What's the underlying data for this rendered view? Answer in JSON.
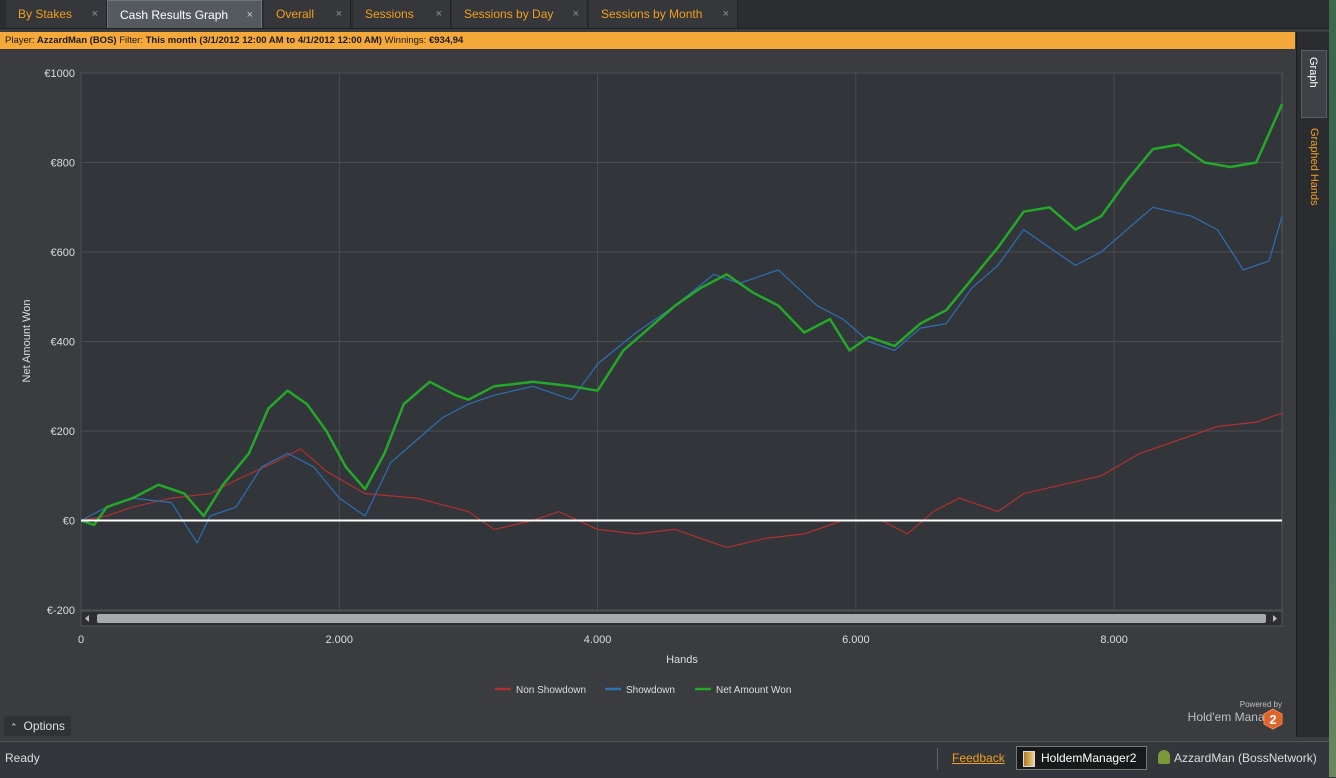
{
  "tabs": [
    {
      "label": "By Stakes",
      "close": "×",
      "active": false
    },
    {
      "label": "Cash Results Graph",
      "close": "×",
      "active": true
    },
    {
      "label": "Overall",
      "close": "×",
      "active": false
    },
    {
      "label": "Sessions",
      "close": "×",
      "active": false
    },
    {
      "label": "Sessions by Day",
      "close": "×",
      "active": false
    },
    {
      "label": "Sessions by Month",
      "close": "×",
      "active": false
    }
  ],
  "filter": {
    "player_label": "Player:",
    "player": "AzzardMan (BOS)",
    "filter_label": "Filter:",
    "filter": "This month (3/1/2012 12:00 AM to 4/1/2012 12:00 AM)",
    "winnings_label": "Winnings:",
    "winnings": "€934,94"
  },
  "side_tabs": {
    "graph": "Graph",
    "graphed_hands": "Graphed Hands"
  },
  "options_label": "Options",
  "brand": {
    "powered": "Powered by",
    "name": "Hold'em Manager",
    "badge": "2"
  },
  "status": {
    "ready": "Ready",
    "feedback": "Feedback",
    "app": "HoldemManager2",
    "user": "AzzardMan (BossNetwork)"
  },
  "icons": {
    "tab_close": "close-icon",
    "options": "chevron-up-icon",
    "app": "holdem-manager-icon",
    "user": "user-icon",
    "badge": "hm2-logo-icon"
  },
  "colors": {
    "accent": "#f0a020",
    "non_showdown": "#b03030",
    "showdown": "#2e6fb4",
    "net": "#23a82a",
    "zero_line": "#ffffff"
  },
  "chart_data": {
    "type": "line",
    "xlabel": "Hands",
    "ylabel": "Net Amount Won",
    "xlim": [
      0,
      9300
    ],
    "ylim": [
      -200,
      1000
    ],
    "x_ticks": [
      0,
      2000,
      4000,
      6000,
      8000
    ],
    "x_tick_labels": [
      "0",
      "2.000",
      "4.000",
      "6.000",
      "8.000"
    ],
    "y_ticks": [
      -200,
      0,
      200,
      400,
      600,
      800,
      1000
    ],
    "y_tick_labels": [
      "€-200",
      "€0",
      "€200",
      "€400",
      "€600",
      "€800",
      "€1000"
    ],
    "grid": true,
    "legend_position": "bottom",
    "series": [
      {
        "name": "Non Showdown",
        "color": "#b03030",
        "points": [
          [
            0,
            0
          ],
          [
            200,
            10
          ],
          [
            400,
            30
          ],
          [
            700,
            50
          ],
          [
            1000,
            60
          ],
          [
            1200,
            90
          ],
          [
            1500,
            130
          ],
          [
            1700,
            160
          ],
          [
            1900,
            110
          ],
          [
            2200,
            60
          ],
          [
            2600,
            50
          ],
          [
            3000,
            20
          ],
          [
            3200,
            -20
          ],
          [
            3500,
            0
          ],
          [
            3700,
            20
          ],
          [
            4000,
            -20
          ],
          [
            4300,
            -30
          ],
          [
            4600,
            -20
          ],
          [
            5000,
            -60
          ],
          [
            5300,
            -40
          ],
          [
            5600,
            -30
          ],
          [
            5900,
            0
          ],
          [
            6200,
            0
          ],
          [
            6400,
            -30
          ],
          [
            6600,
            20
          ],
          [
            6800,
            50
          ],
          [
            7100,
            20
          ],
          [
            7300,
            60
          ],
          [
            7600,
            80
          ],
          [
            7900,
            100
          ],
          [
            8200,
            150
          ],
          [
            8500,
            180
          ],
          [
            8800,
            210
          ],
          [
            9100,
            220
          ],
          [
            9300,
            240
          ]
        ]
      },
      {
        "name": "Showdown",
        "color": "#2e6fb4",
        "points": [
          [
            0,
            0
          ],
          [
            200,
            30
          ],
          [
            400,
            50
          ],
          [
            700,
            40
          ],
          [
            900,
            -50
          ],
          [
            1000,
            10
          ],
          [
            1200,
            30
          ],
          [
            1400,
            120
          ],
          [
            1600,
            150
          ],
          [
            1800,
            120
          ],
          [
            2000,
            50
          ],
          [
            2200,
            10
          ],
          [
            2400,
            130
          ],
          [
            2600,
            180
          ],
          [
            2800,
            230
          ],
          [
            3000,
            260
          ],
          [
            3200,
            280
          ],
          [
            3500,
            300
          ],
          [
            3800,
            270
          ],
          [
            4000,
            350
          ],
          [
            4300,
            420
          ],
          [
            4600,
            480
          ],
          [
            4900,
            550
          ],
          [
            5100,
            530
          ],
          [
            5400,
            560
          ],
          [
            5700,
            480
          ],
          [
            5900,
            450
          ],
          [
            6100,
            400
          ],
          [
            6300,
            380
          ],
          [
            6500,
            430
          ],
          [
            6700,
            440
          ],
          [
            6900,
            520
          ],
          [
            7100,
            570
          ],
          [
            7300,
            650
          ],
          [
            7500,
            610
          ],
          [
            7700,
            570
          ],
          [
            7900,
            600
          ],
          [
            8100,
            650
          ],
          [
            8300,
            700
          ],
          [
            8600,
            680
          ],
          [
            8800,
            650
          ],
          [
            9000,
            560
          ],
          [
            9200,
            580
          ],
          [
            9300,
            680
          ]
        ]
      },
      {
        "name": "Net Amount Won",
        "color": "#23a82a",
        "points": [
          [
            0,
            0
          ],
          [
            100,
            -10
          ],
          [
            200,
            30
          ],
          [
            400,
            50
          ],
          [
            600,
            80
          ],
          [
            800,
            60
          ],
          [
            950,
            10
          ],
          [
            1100,
            80
          ],
          [
            1300,
            150
          ],
          [
            1450,
            250
          ],
          [
            1600,
            290
          ],
          [
            1750,
            260
          ],
          [
            1900,
            200
          ],
          [
            2050,
            120
          ],
          [
            2200,
            70
          ],
          [
            2350,
            150
          ],
          [
            2500,
            260
          ],
          [
            2700,
            310
          ],
          [
            2900,
            280
          ],
          [
            3000,
            270
          ],
          [
            3200,
            300
          ],
          [
            3500,
            310
          ],
          [
            3800,
            300
          ],
          [
            4000,
            290
          ],
          [
            4200,
            380
          ],
          [
            4400,
            430
          ],
          [
            4600,
            480
          ],
          [
            4800,
            520
          ],
          [
            5000,
            550
          ],
          [
            5200,
            510
          ],
          [
            5400,
            480
          ],
          [
            5600,
            420
          ],
          [
            5800,
            450
          ],
          [
            5950,
            380
          ],
          [
            6100,
            410
          ],
          [
            6300,
            390
          ],
          [
            6500,
            440
          ],
          [
            6700,
            470
          ],
          [
            6900,
            540
          ],
          [
            7100,
            610
          ],
          [
            7300,
            690
          ],
          [
            7500,
            700
          ],
          [
            7700,
            650
          ],
          [
            7900,
            680
          ],
          [
            8100,
            760
          ],
          [
            8300,
            830
          ],
          [
            8500,
            840
          ],
          [
            8700,
            800
          ],
          [
            8900,
            790
          ],
          [
            9100,
            800
          ],
          [
            9300,
            930
          ]
        ]
      }
    ]
  }
}
